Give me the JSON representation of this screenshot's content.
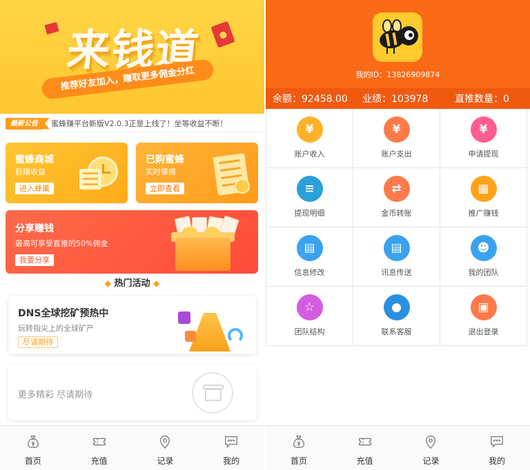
{
  "left": {
    "banner": {
      "title": "来钱道",
      "slogan": "推荐好友加入，赚取更多佣金分红"
    },
    "notice": {
      "tag": "最新公告",
      "text": "蜜蜂赚平台新版V2.0.3正是上线了！坐等收益不断！"
    },
    "cards": {
      "shop": {
        "title": "蜜蜂商城",
        "sub": "稳赚收益",
        "button": "进入蜂巢"
      },
      "bought": {
        "title": "已购蜜蜂",
        "sub": "实时掌握",
        "button": "立即查看"
      },
      "share": {
        "title": "分享赚钱",
        "sub": "最高可享受直推的50%佣金",
        "button": "我要分享"
      }
    },
    "hot": {
      "title": "热门活动"
    },
    "promo": {
      "title": "DNS全球挖矿预热中",
      "sub": "玩转指尖上的全球矿产",
      "button": "尽请期待"
    },
    "more": {
      "text": "更多精彩 尽请期待"
    }
  },
  "tabs": [
    {
      "label": "首页",
      "icon": "money-bag-icon"
    },
    {
      "label": "充值",
      "icon": "ticket-icon"
    },
    {
      "label": "记录",
      "icon": "location-pin-icon"
    },
    {
      "label": "我的",
      "icon": "chat-bubble-icon"
    }
  ],
  "right": {
    "user": {
      "id_label": "我的ID：",
      "id_value": "13826909874"
    },
    "stats": {
      "balance_label": "余额：",
      "balance_value": "92458.00",
      "perf_label": "业绩：",
      "perf_value": "103978",
      "direct_label": "直推数量：",
      "direct_value": "0"
    },
    "menu": [
      {
        "label": "账户收入",
        "icon": "income-icon",
        "color": "#ffb12a"
      },
      {
        "label": "账户支出",
        "icon": "expense-icon",
        "color": "#ff7a4a"
      },
      {
        "label": "申请提现",
        "icon": "withdraw-icon",
        "color": "#ff5d8f"
      },
      {
        "label": "提现明细",
        "icon": "details-icon",
        "color": "#2b9fd9"
      },
      {
        "label": "金币转账",
        "icon": "transfer-icon",
        "color": "#ff7a4a"
      },
      {
        "label": "推广赚钱",
        "icon": "promote-icon",
        "color": "#ffa21a"
      },
      {
        "label": "信息修改",
        "icon": "edit-info-icon",
        "color": "#3aa2f0"
      },
      {
        "label": "讯息传送",
        "icon": "message-icon",
        "color": "#3aa2f0"
      },
      {
        "label": "我的团队",
        "icon": "team-icon",
        "color": "#3aa2f0"
      },
      {
        "label": "团队结构",
        "icon": "star-icon",
        "color": "#d35de0"
      },
      {
        "label": "联系客服",
        "icon": "service-icon",
        "color": "#2b8fe0"
      },
      {
        "label": "退出登录",
        "icon": "logout-icon",
        "color": "#ff7a4a"
      }
    ]
  }
}
